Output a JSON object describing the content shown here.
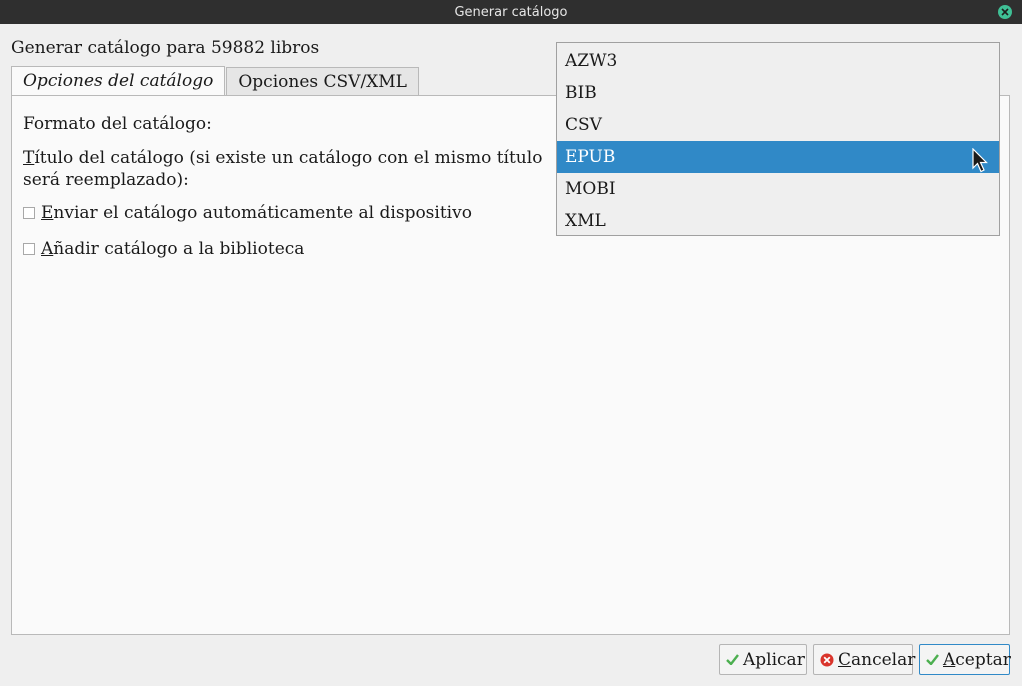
{
  "window": {
    "title": "Generar catálogo"
  },
  "heading": "Generar catálogo para 59882 libros",
  "tabs": [
    {
      "label": "Opciones del catálogo",
      "active": true
    },
    {
      "label": "Opciones CSV/XML",
      "active": false
    }
  ],
  "form": {
    "format_label": "Formato del catálogo:",
    "title_label_first": "T",
    "title_label_rest": "ítulo del catálogo (si existe un catálogo con el mismo título",
    "title_label_line2": "será reemplazado):",
    "send_first": "E",
    "send_rest": "nviar el catálogo automáticamente al dispositivo",
    "add_first": "A",
    "add_rest": "ñadir catálogo a la biblioteca"
  },
  "format_options": [
    "AZW3",
    "BIB",
    "CSV",
    "EPUB",
    "MOBI",
    "XML"
  ],
  "format_selected": "EPUB",
  "buttons": {
    "apply": "Aplicar",
    "cancel_first": "C",
    "cancel_rest": "ancelar",
    "accept_first": "A",
    "accept_rest": "ceptar"
  },
  "icons": {
    "close": "close-icon",
    "check": "check-icon",
    "cancel": "cancel-icon"
  },
  "colors": {
    "titlebar": "#2f2f2f",
    "accent": "#3089c7",
    "close": "#3fbf95",
    "cancel_red": "#d9342b",
    "check_green": "#4caf50"
  }
}
